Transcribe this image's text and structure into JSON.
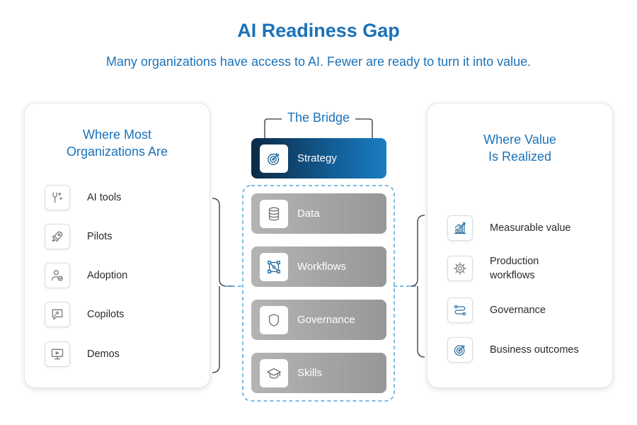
{
  "title": "AI Readiness Gap",
  "subtitle": "Many organizations have access to AI. Fewer are ready to turn it into value.",
  "left_panel": {
    "heading_line1": "Where Most",
    "heading_line2": "Organizations Are",
    "items": [
      {
        "label": "AI tools",
        "icon": "ai-tools-icon"
      },
      {
        "label": "Pilots",
        "icon": "rocket-icon"
      },
      {
        "label": "Adoption",
        "icon": "user-check-icon"
      },
      {
        "label": "Copilots",
        "icon": "sparkle-chat-icon"
      },
      {
        "label": "Demos",
        "icon": "presentation-icon"
      }
    ]
  },
  "bridge": {
    "title": "The Bridge",
    "cards": [
      {
        "label": "Strategy",
        "icon": "target-icon"
      },
      {
        "label": "Data",
        "icon": "database-icon"
      },
      {
        "label": "Workflows",
        "icon": "network-icon"
      },
      {
        "label": "Governance",
        "icon": "shield-icon"
      },
      {
        "label": "Skills",
        "icon": "graduation-cap-icon"
      }
    ]
  },
  "right_panel": {
    "heading_line1": "Where Value",
    "heading_line2": "Is Realized",
    "items": [
      {
        "label_line1": "Measurable value",
        "label_line2": "",
        "icon": "bar-chart-icon"
      },
      {
        "label_line1": "Production",
        "label_line2": "workflows",
        "icon": "gear-icon"
      },
      {
        "label_line1": "Governance",
        "label_line2": "",
        "icon": "flow-icon"
      },
      {
        "label_line1": "Business outcomes",
        "label_line2": "",
        "icon": "target-icon"
      }
    ]
  },
  "colors": {
    "accent_blue": "#1b72b8",
    "dashed_blue": "#4fa7dc",
    "strategy_dark": "#0c2a45",
    "card_gray": "#a6a6a6",
    "icon_gray": "#7a7a7a",
    "icon_blue": "#2a6f9f"
  }
}
